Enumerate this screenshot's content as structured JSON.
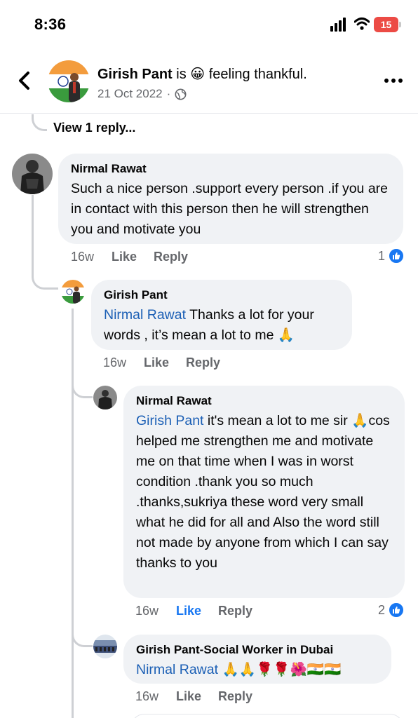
{
  "status_bar": {
    "time": "8:36",
    "battery": "15"
  },
  "header": {
    "name": "Girish Pant",
    "feeling_prefix": "is",
    "feeling_emoji": "😀",
    "feeling_text": "feeling thankful.",
    "date": "21 Oct 2022",
    "separator": "·",
    "audience_icon": "globe-icon"
  },
  "view_replies": "View 1 reply...",
  "comments": [
    {
      "author": "Nirmal Rawat",
      "text": "Such a nice person .support every person .if you are in contact with this person then he will strengthen you and motivate you",
      "time": "16w",
      "like": "Like",
      "reply": "Reply",
      "reactions": "1"
    },
    {
      "author": "Girish Pant",
      "mention": "Nirmal Rawat",
      "text": " Thanks a lot for your words , it’s mean a lot to me 🙏",
      "time": "16w",
      "like": "Like",
      "reply": "Reply"
    },
    {
      "author": "Nirmal Rawat",
      "mention": "Girish Pant",
      "text": "  it's mean a lot to me sir 🙏cos helped me strengthen me and motivate me on that time when I was in worst condition .thank you so much .thanks,sukriya these word very small what he did for all and Also the word still not made by anyone from which I can say thanks to you",
      "time": "16w",
      "like": "Like",
      "reply": "Reply",
      "reactions": "2"
    },
    {
      "author": "Girish Pant-Social Worker in Dubai",
      "mention": "Nirmal Rawat",
      "text": " 🙏🙏🌹🌹🌺🇮🇳🇮🇳",
      "time": "16w",
      "like": "Like",
      "reply": "Reply"
    }
  ],
  "colors": {
    "link": "#1b5fb5",
    "like_blue": "#1877f2",
    "bubble": "#f0f2f5",
    "meta_gray": "#65676b"
  }
}
